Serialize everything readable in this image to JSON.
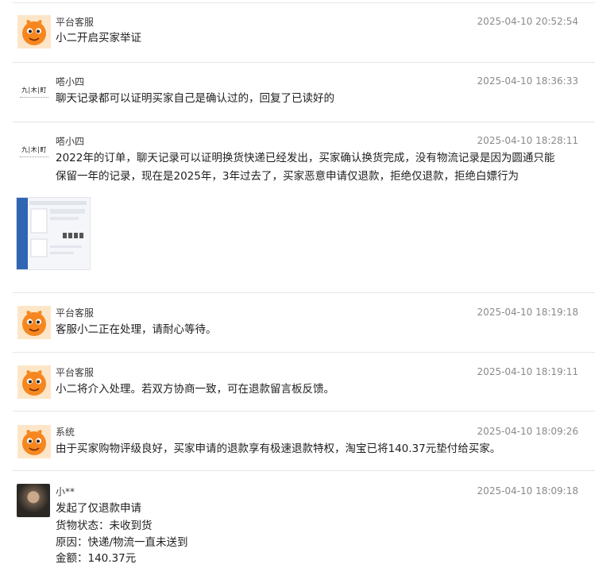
{
  "messages": [
    {
      "sender": "平台客服",
      "time": "2025-04-10 20:52:54",
      "lines": [
        "小二开启买家举证"
      ],
      "avatar": "taobao-mascot-icon"
    },
    {
      "sender": "嗒小四",
      "time": "2025-04-10 18:36:33",
      "lines": [
        "聊天记录都可以证明买家自己是确认过的，回复了已读好的"
      ],
      "avatar": "shop-logo",
      "logo_text": "九|木|町"
    },
    {
      "sender": "嗒小四",
      "time": "2025-04-10 18:28:11",
      "lines": [
        "2022年的订单，聊天记录可以证明换货快递已经发出，买家确认换货完成，没有物流记录是因为圆通只能",
        "保留一年的记录，现在是2025年，3年过去了，买家恶意申请仅退款，拒绝仅退款，拒绝白嫖行为"
      ],
      "avatar": "shop-logo",
      "logo_text": "九|木|町",
      "has_attachment": true
    },
    {
      "sender": "平台客服",
      "time": "2025-04-10 18:19:18",
      "lines": [
        "客服小二正在处理，请耐心等待。"
      ],
      "avatar": "taobao-mascot-icon"
    },
    {
      "sender": "平台客服",
      "time": "2025-04-10 18:19:11",
      "lines": [
        "小二将介入处理。若双方协商一致，可在退款留言板反馈。"
      ],
      "avatar": "taobao-mascot-icon"
    },
    {
      "sender": "系统",
      "time": "2025-04-10 18:09:26",
      "lines": [
        "由于买家购物评级良好，买家申请的退款享有极速退款特权，淘宝已将140.37元垫付给买家。"
      ],
      "avatar": "taobao-mascot-icon"
    },
    {
      "sender": "小**",
      "time": "2025-04-10 18:09:18",
      "lines": [
        "发起了仅退款申请",
        "货物状态：未收到货",
        "原因：快递/物流一直未送到",
        "金额：140.37元"
      ],
      "avatar": "user-photo"
    }
  ]
}
